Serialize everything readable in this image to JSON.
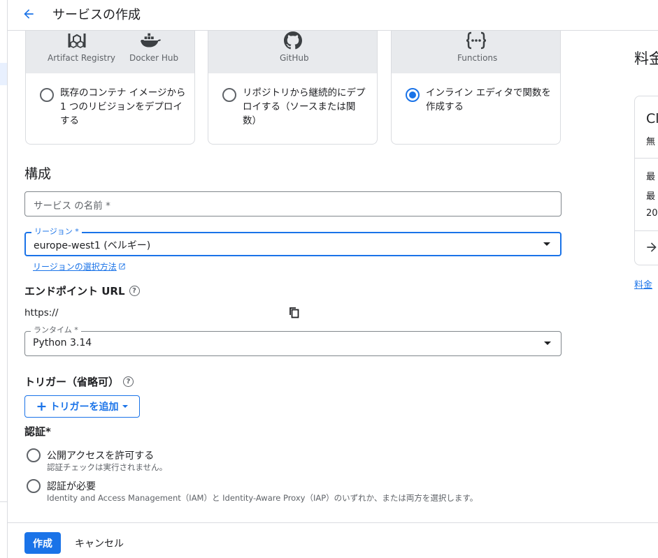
{
  "header": {
    "title": "サービスの作成",
    "back_icon": "arrow-back-icon"
  },
  "source_cards": [
    {
      "icons": [
        "artifact-registry-icon",
        "docker-icon"
      ],
      "labels": [
        "Artifact Registry",
        "Docker Hub"
      ],
      "text": "既存のコンテナ イメージから 1 つのリビジョンをデプロイする",
      "selected": false
    },
    {
      "icons": [
        "github-icon"
      ],
      "labels": [
        "GitHub"
      ],
      "text": "リポジトリから継続的にデプロイする（ソースまたは関数）",
      "selected": false
    },
    {
      "icons": [
        "functions-icon"
      ],
      "labels": [
        "Functions"
      ],
      "text": "インライン エディタで関数を作成する",
      "selected": true
    }
  ],
  "config": {
    "heading": "構成",
    "service_name": {
      "placeholder": "サービス の名前 *",
      "value": ""
    },
    "region": {
      "label": "リージョン *",
      "value": "europe-west1 (ベルギー)",
      "help_link": "リージョンの選択方法"
    },
    "endpoint": {
      "heading": "エンドポイント URL",
      "url": "https://"
    },
    "runtime": {
      "label": "ランタイム *",
      "value": "Python 3.14"
    },
    "trigger": {
      "heading": "トリガー（省略可）",
      "add_button": "トリガーを追加"
    },
    "auth": {
      "heading": "認証*",
      "options": [
        {
          "title": "公開アクセスを許可する",
          "desc": "認証チェックは実行されません。"
        },
        {
          "title": "認証が必要",
          "desc": "Identity and Access Management（IAM）と Identity-Aware Proxy（IAP）のいずれか、または両方を選択します。"
        }
      ]
    }
  },
  "footer": {
    "create": "作成",
    "cancel": "キャンセル"
  },
  "side_panel": {
    "title": "料金",
    "card_title": "Cl",
    "line1": "無",
    "line2": "最",
    "line3": "最",
    "line4": "20",
    "link": "料金"
  },
  "colors": {
    "accent": "#1a73e8",
    "card_header": "#e8eaed",
    "border": "#dadce0"
  }
}
